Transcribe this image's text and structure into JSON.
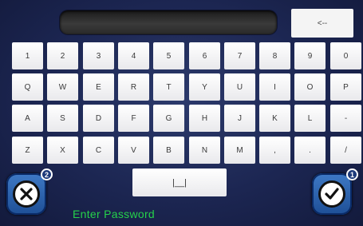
{
  "keyboard": {
    "backspace_label": "<--",
    "rows": [
      [
        "1",
        "2",
        "3",
        "4",
        "5",
        "6",
        "7",
        "8",
        "9",
        "0"
      ],
      [
        "Q",
        "W",
        "E",
        "R",
        "T",
        "Y",
        "U",
        "I",
        "O",
        "P"
      ],
      [
        "A",
        "S",
        "D",
        "F",
        "G",
        "H",
        "J",
        "K",
        "L",
        "-"
      ],
      [
        "Z",
        "X",
        "C",
        "V",
        "B",
        "N",
        "M",
        ",",
        ".",
        "/"
      ]
    ],
    "space_label": "|__|"
  },
  "buttons": {
    "cancel_badge": "2",
    "ok_badge": "1"
  },
  "prompt": "Enter Password",
  "colors": {
    "background": "#1c2652",
    "key": "#ffffff",
    "button_blue": "#2d64b0",
    "prompt_green": "#25d14a"
  },
  "icons": {
    "cancel": "x-circle-icon",
    "ok": "checkmark-circle-icon"
  }
}
